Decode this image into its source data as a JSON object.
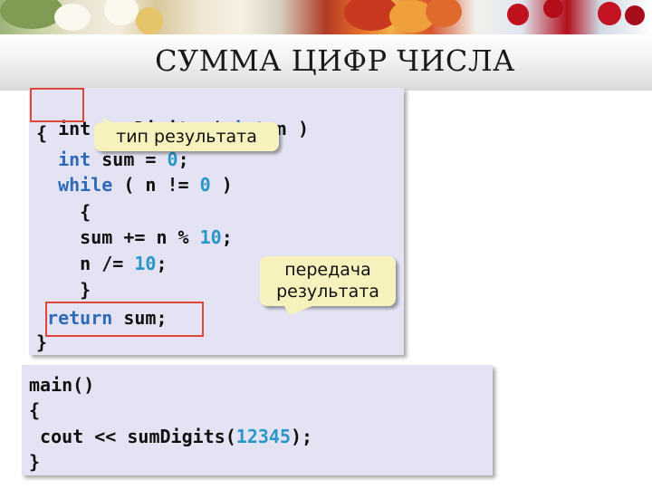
{
  "slide": {
    "title": "СУММА ЦИФР ЧИСЛА"
  },
  "function_code": {
    "return_type": "int",
    "signature_rest": "sumDigits ( ",
    "param_type": "int",
    "param_rest": " n )",
    "open_brace": "{",
    "decl_type": "int",
    "decl_rest": " sum = ",
    "decl_value": "0",
    "decl_end": ";",
    "while_kw": "while",
    "while_cond": " ( n != ",
    "while_value": "0",
    "while_end": " )",
    "inner_open": "{",
    "sum_stmt": "sum += n % ",
    "sum_value": "10",
    "sum_end": ";",
    "div_stmt": "n /= ",
    "div_value": "10",
    "div_end": ";",
    "inner_close": "}",
    "return_kw": "return",
    "return_rest": " sum;",
    "close_brace": "}"
  },
  "main_code": {
    "line1": "main()",
    "line2": "{",
    "call_start": " cout << sumDigits(",
    "call_value": "12345",
    "call_end": ");",
    "line4": "}"
  },
  "callouts": {
    "result_type": "тип результата",
    "result_pass_1": "передача",
    "result_pass_2": "результата"
  },
  "colors": {
    "keyword": "#2e6ab8",
    "number": "#2b97c8",
    "frame": "#e0463c",
    "callout_bg": "#f7f2bd",
    "code_bg": "#e3e3f3"
  }
}
